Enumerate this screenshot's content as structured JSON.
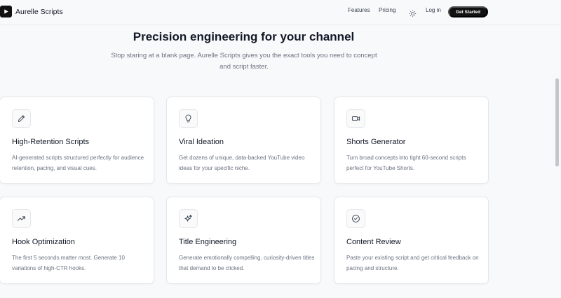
{
  "brand": {
    "name": "Aurelle Scripts",
    "logo_icon": "play-icon"
  },
  "nav": {
    "features": "Features",
    "pricing": "Pricing",
    "theme_icon": "sun-icon",
    "login": "Log in",
    "cta": "Get Started"
  },
  "hero": {
    "title": "Precision engineering for your channel",
    "subtitle": "Stop staring at a blank page. Aurelle Scripts gives you the exact tools you need to concept and script faster."
  },
  "features": [
    {
      "icon": "pencil-icon",
      "title": "High-Retention Scripts",
      "description": "AI-generated scripts structured perfectly for audience retention, pacing, and visual cues."
    },
    {
      "icon": "lightbulb-icon",
      "title": "Viral Ideation",
      "description": "Get dozens of unique, data-backed YouTube video ideas for your specific niche."
    },
    {
      "icon": "video-camera-icon",
      "title": "Shorts Generator",
      "description": "Turn broad concepts into tight 60-second scripts perfect for YouTube Shorts."
    },
    {
      "icon": "trending-up-icon",
      "title": "Hook Optimization",
      "description": "The first 5 seconds matter most. Generate 10 variations of high-CTR hooks."
    },
    {
      "icon": "sparkles-icon",
      "title": "Title Engineering",
      "description": "Generate emotionally compelling, curiosity-driven titles that demand to be clicked."
    },
    {
      "icon": "check-circle-icon",
      "title": "Content Review",
      "description": "Paste your existing script and get critical feedback on pacing and structure."
    }
  ],
  "colors": {
    "accent": "#111111",
    "muted_text": "#6b7280",
    "background": "#f8f9fa"
  }
}
